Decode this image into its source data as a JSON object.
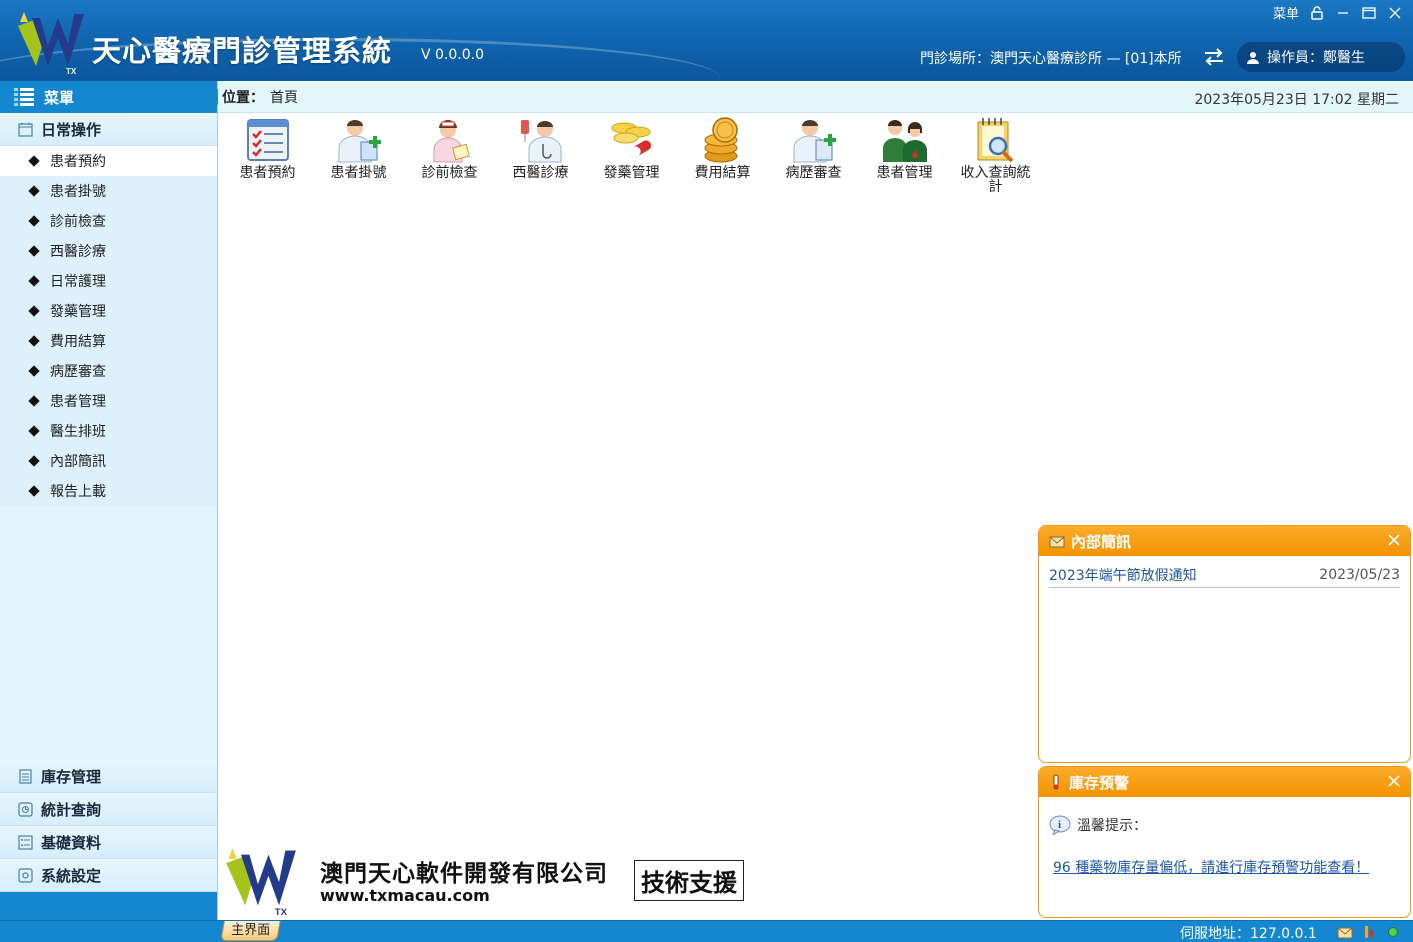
{
  "header": {
    "title": "天心醫療門診管理系統",
    "version": "V 0.0.0.0",
    "menu_label": "菜单",
    "clinic_info": "門診場所：澳門天心醫療診所 — [01]本所",
    "operator": "操作員：鄭醫生"
  },
  "sidebar": {
    "menu_title": "菜單",
    "daily_group": "日常操作",
    "items": [
      {
        "label": "患者預約"
      },
      {
        "label": "患者掛號"
      },
      {
        "label": "診前檢查"
      },
      {
        "label": "西醫診療"
      },
      {
        "label": "日常護理"
      },
      {
        "label": "發藥管理"
      },
      {
        "label": "費用結算"
      },
      {
        "label": "病歷審查"
      },
      {
        "label": "患者管理"
      },
      {
        "label": "醫生排班"
      },
      {
        "label": "內部簡訊"
      },
      {
        "label": "報告上載"
      }
    ],
    "bottom_groups": [
      {
        "label": "庫存管理"
      },
      {
        "label": "統計查詢"
      },
      {
        "label": "基礎資料"
      },
      {
        "label": "系統設定"
      }
    ]
  },
  "location": {
    "label": "位置：",
    "value": "首頁",
    "datetime": "2023年05月23日 17:02  星期二"
  },
  "shortcuts": [
    {
      "label": "患者預約",
      "icon": "checklist-icon"
    },
    {
      "label": "患者掛號",
      "icon": "doctor-register-icon"
    },
    {
      "label": "診前檢查",
      "icon": "nurse-icon"
    },
    {
      "label": "西醫診療",
      "icon": "doctor-iv-icon"
    },
    {
      "label": "發藥管理",
      "icon": "pills-icon"
    },
    {
      "label": "費用結算",
      "icon": "coins-icon"
    },
    {
      "label": "病歷審查",
      "icon": "doctor-record-icon"
    },
    {
      "label": "患者管理",
      "icon": "patients-icon"
    },
    {
      "label": "收入查詢統計",
      "icon": "notepad-search-icon"
    }
  ],
  "company": {
    "name": "澳門天心軟件開發有限公司",
    "url": "www.txmacau.com",
    "support": "技術支援"
  },
  "messages_panel": {
    "title": "內部簡訊",
    "items": [
      {
        "title": "2023年端午節放假通知",
        "date": "2023/05/23"
      }
    ]
  },
  "stock_panel": {
    "title": "庫存預警",
    "tip": "溫馨提示：",
    "alert": "96 種藥物庫存量偏低，請進行庫存預警功能查看！"
  },
  "statusbar": {
    "main_tab": "主界面",
    "server": "伺服地址：127.0.0.1"
  },
  "colors": {
    "header_blue": "#0f63ad",
    "accent_blue": "#1487d0",
    "panel_orange": "#f39300",
    "sidebar_bg": "#e3f3fc"
  }
}
